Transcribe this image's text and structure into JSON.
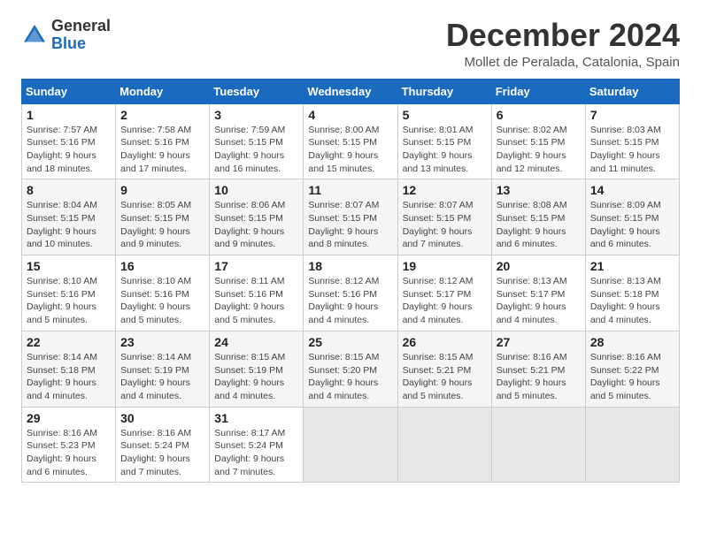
{
  "logo": {
    "general": "General",
    "blue": "Blue"
  },
  "title": "December 2024",
  "location": "Mollet de Peralada, Catalonia, Spain",
  "days_of_week": [
    "Sunday",
    "Monday",
    "Tuesday",
    "Wednesday",
    "Thursday",
    "Friday",
    "Saturday"
  ],
  "weeks": [
    [
      {
        "day": "1",
        "info": "Sunrise: 7:57 AM\nSunset: 5:16 PM\nDaylight: 9 hours\nand 18 minutes."
      },
      {
        "day": "2",
        "info": "Sunrise: 7:58 AM\nSunset: 5:16 PM\nDaylight: 9 hours\nand 17 minutes."
      },
      {
        "day": "3",
        "info": "Sunrise: 7:59 AM\nSunset: 5:15 PM\nDaylight: 9 hours\nand 16 minutes."
      },
      {
        "day": "4",
        "info": "Sunrise: 8:00 AM\nSunset: 5:15 PM\nDaylight: 9 hours\nand 15 minutes."
      },
      {
        "day": "5",
        "info": "Sunrise: 8:01 AM\nSunset: 5:15 PM\nDaylight: 9 hours\nand 13 minutes."
      },
      {
        "day": "6",
        "info": "Sunrise: 8:02 AM\nSunset: 5:15 PM\nDaylight: 9 hours\nand 12 minutes."
      },
      {
        "day": "7",
        "info": "Sunrise: 8:03 AM\nSunset: 5:15 PM\nDaylight: 9 hours\nand 11 minutes."
      }
    ],
    [
      {
        "day": "8",
        "info": "Sunrise: 8:04 AM\nSunset: 5:15 PM\nDaylight: 9 hours\nand 10 minutes."
      },
      {
        "day": "9",
        "info": "Sunrise: 8:05 AM\nSunset: 5:15 PM\nDaylight: 9 hours\nand 9 minutes."
      },
      {
        "day": "10",
        "info": "Sunrise: 8:06 AM\nSunset: 5:15 PM\nDaylight: 9 hours\nand 9 minutes."
      },
      {
        "day": "11",
        "info": "Sunrise: 8:07 AM\nSunset: 5:15 PM\nDaylight: 9 hours\nand 8 minutes."
      },
      {
        "day": "12",
        "info": "Sunrise: 8:07 AM\nSunset: 5:15 PM\nDaylight: 9 hours\nand 7 minutes."
      },
      {
        "day": "13",
        "info": "Sunrise: 8:08 AM\nSunset: 5:15 PM\nDaylight: 9 hours\nand 6 minutes."
      },
      {
        "day": "14",
        "info": "Sunrise: 8:09 AM\nSunset: 5:15 PM\nDaylight: 9 hours\nand 6 minutes."
      }
    ],
    [
      {
        "day": "15",
        "info": "Sunrise: 8:10 AM\nSunset: 5:16 PM\nDaylight: 9 hours\nand 5 minutes."
      },
      {
        "day": "16",
        "info": "Sunrise: 8:10 AM\nSunset: 5:16 PM\nDaylight: 9 hours\nand 5 minutes."
      },
      {
        "day": "17",
        "info": "Sunrise: 8:11 AM\nSunset: 5:16 PM\nDaylight: 9 hours\nand 5 minutes."
      },
      {
        "day": "18",
        "info": "Sunrise: 8:12 AM\nSunset: 5:16 PM\nDaylight: 9 hours\nand 4 minutes."
      },
      {
        "day": "19",
        "info": "Sunrise: 8:12 AM\nSunset: 5:17 PM\nDaylight: 9 hours\nand 4 minutes."
      },
      {
        "day": "20",
        "info": "Sunrise: 8:13 AM\nSunset: 5:17 PM\nDaylight: 9 hours\nand 4 minutes."
      },
      {
        "day": "21",
        "info": "Sunrise: 8:13 AM\nSunset: 5:18 PM\nDaylight: 9 hours\nand 4 minutes."
      }
    ],
    [
      {
        "day": "22",
        "info": "Sunrise: 8:14 AM\nSunset: 5:18 PM\nDaylight: 9 hours\nand 4 minutes."
      },
      {
        "day": "23",
        "info": "Sunrise: 8:14 AM\nSunset: 5:19 PM\nDaylight: 9 hours\nand 4 minutes."
      },
      {
        "day": "24",
        "info": "Sunrise: 8:15 AM\nSunset: 5:19 PM\nDaylight: 9 hours\nand 4 minutes."
      },
      {
        "day": "25",
        "info": "Sunrise: 8:15 AM\nSunset: 5:20 PM\nDaylight: 9 hours\nand 4 minutes."
      },
      {
        "day": "26",
        "info": "Sunrise: 8:15 AM\nSunset: 5:21 PM\nDaylight: 9 hours\nand 5 minutes."
      },
      {
        "day": "27",
        "info": "Sunrise: 8:16 AM\nSunset: 5:21 PM\nDaylight: 9 hours\nand 5 minutes."
      },
      {
        "day": "28",
        "info": "Sunrise: 8:16 AM\nSunset: 5:22 PM\nDaylight: 9 hours\nand 5 minutes."
      }
    ],
    [
      {
        "day": "29",
        "info": "Sunrise: 8:16 AM\nSunset: 5:23 PM\nDaylight: 9 hours\nand 6 minutes."
      },
      {
        "day": "30",
        "info": "Sunrise: 8:16 AM\nSunset: 5:24 PM\nDaylight: 9 hours\nand 7 minutes."
      },
      {
        "day": "31",
        "info": "Sunrise: 8:17 AM\nSunset: 5:24 PM\nDaylight: 9 hours\nand 7 minutes."
      },
      {
        "day": "",
        "info": ""
      },
      {
        "day": "",
        "info": ""
      },
      {
        "day": "",
        "info": ""
      },
      {
        "day": "",
        "info": ""
      }
    ]
  ]
}
